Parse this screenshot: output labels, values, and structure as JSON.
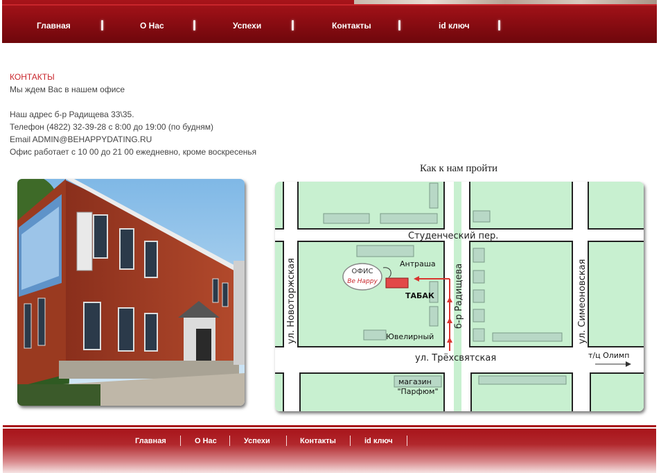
{
  "nav": {
    "items": [
      "Главная",
      "О Нас",
      "Успехи",
      "Контакты",
      "id ключ"
    ]
  },
  "contacts": {
    "heading": "КОНТАКТЫ",
    "welcome": "Мы ждем Вас в нашем офисе",
    "address": "Наш адрес б-р Радищева 33\\35.",
    "phone": "Телефон (4822) 32-39-28 с 8:00 до 19:00 (по будням)",
    "email": "Email ADMIN@BEHAPPYDATING.RU",
    "office_hours": "Офис работает с 10 00 до 21 00 ежедневно, кроме воскресенья"
  },
  "map": {
    "caption": "Как к нам пройти",
    "labels": {
      "studencheskiy": "Студенческий пер.",
      "novotorzhskaya": "ул. Новоторжская",
      "radishcheva": "б-р Радищева",
      "simeonovskaya": "ул. Симеоновская",
      "tryokhsvyatskaya": "ул. Трёхсвятская",
      "antrasha": "Антраша",
      "tabak": "ТАБАК",
      "juvelirny": "Ювелирный",
      "office": "ОФИС",
      "office_logo": "Be Happy",
      "parfum_1": "магазин",
      "parfum_2": "\"Парфюм\"",
      "olimp": "т/ц Олимп"
    },
    "colors": {
      "block": "#c8f0d0",
      "road": "#ffffff",
      "building": "#b8d8c6",
      "route": "#d9342e"
    }
  },
  "footer": {
    "items": [
      "Главная",
      "О Нас",
      "Успехи",
      "Контакты",
      "id ключ"
    ]
  },
  "colors": {
    "brand_red": "#8e0d13",
    "heading_red": "#c9262c"
  }
}
